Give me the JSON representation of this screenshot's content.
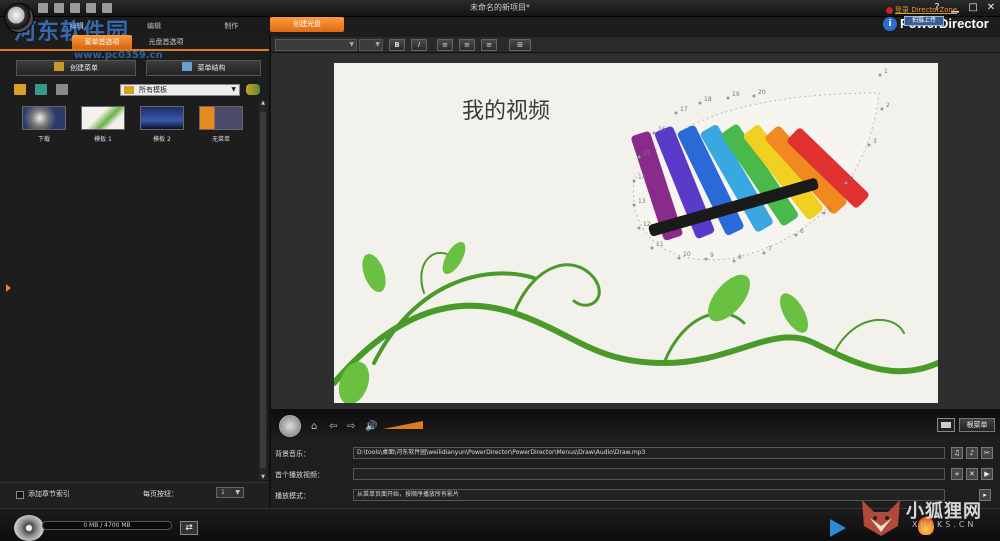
{
  "window": {
    "title": "未命名的新项目*"
  },
  "brand": {
    "login": "登录 DirectorZone",
    "product": "PowerDirector",
    "upload_tooltip": "拍摄上传",
    "watermark": "河东软件园",
    "watermark_url": "www.pc0359.cn"
  },
  "mode_tabs": [
    "编辑",
    "编辑",
    "制作"
  ],
  "create_disc_tab": "创建光盘",
  "sub_tabs": [
    "菜单首选项",
    "光盘首选项"
  ],
  "left_panel": {
    "create_menu": "创建菜单",
    "menu_structure": "菜单结构",
    "filter": "所有模板",
    "templates": [
      {
        "label": "下载",
        "icon": "download-globe-icon"
      },
      {
        "label": "模板 1",
        "icon": "template-1-thumbnail"
      },
      {
        "label": "模板 2",
        "icon": "template-2-thumbnail"
      },
      {
        "label": "无菜单",
        "icon": "no-menu-thumbnail"
      }
    ],
    "add_index": "添加章节索引",
    "per_page_label": "每页按钮：",
    "per_page_value": "1"
  },
  "preview": {
    "title": "我的视频",
    "dot_numbers": [
      "1",
      "2",
      "3",
      "4",
      "5",
      "6",
      "7",
      "8",
      "9",
      "10",
      "11",
      "12",
      "13",
      "14",
      "15",
      "16",
      "17",
      "18",
      "19",
      "20"
    ]
  },
  "player": {
    "root_menu": "根菜单"
  },
  "props": {
    "bg_music_label": "背景音乐：",
    "bg_music_path": "D:\\tools\\桌面\\河东软件园\\weilidianyun\\PowerDirector\\PowerDirector\\Menus\\Draw\\Audio\\Draw.mp3",
    "first_play_label": "首个播放视频：",
    "first_play_value": "",
    "play_mode_label": "播放模式：",
    "play_mode_value": "从菜单页面开始，按顺序播放所有影片"
  },
  "status": {
    "capacity": "0 MB / 4700 MB"
  },
  "overlay": {
    "site": "小狐狸网",
    "site_url": "XHLKS.CN"
  },
  "colors": {
    "accent": "#e07a20",
    "panel": "#1d1d1d",
    "brand_blue": "#2a6fd0"
  }
}
